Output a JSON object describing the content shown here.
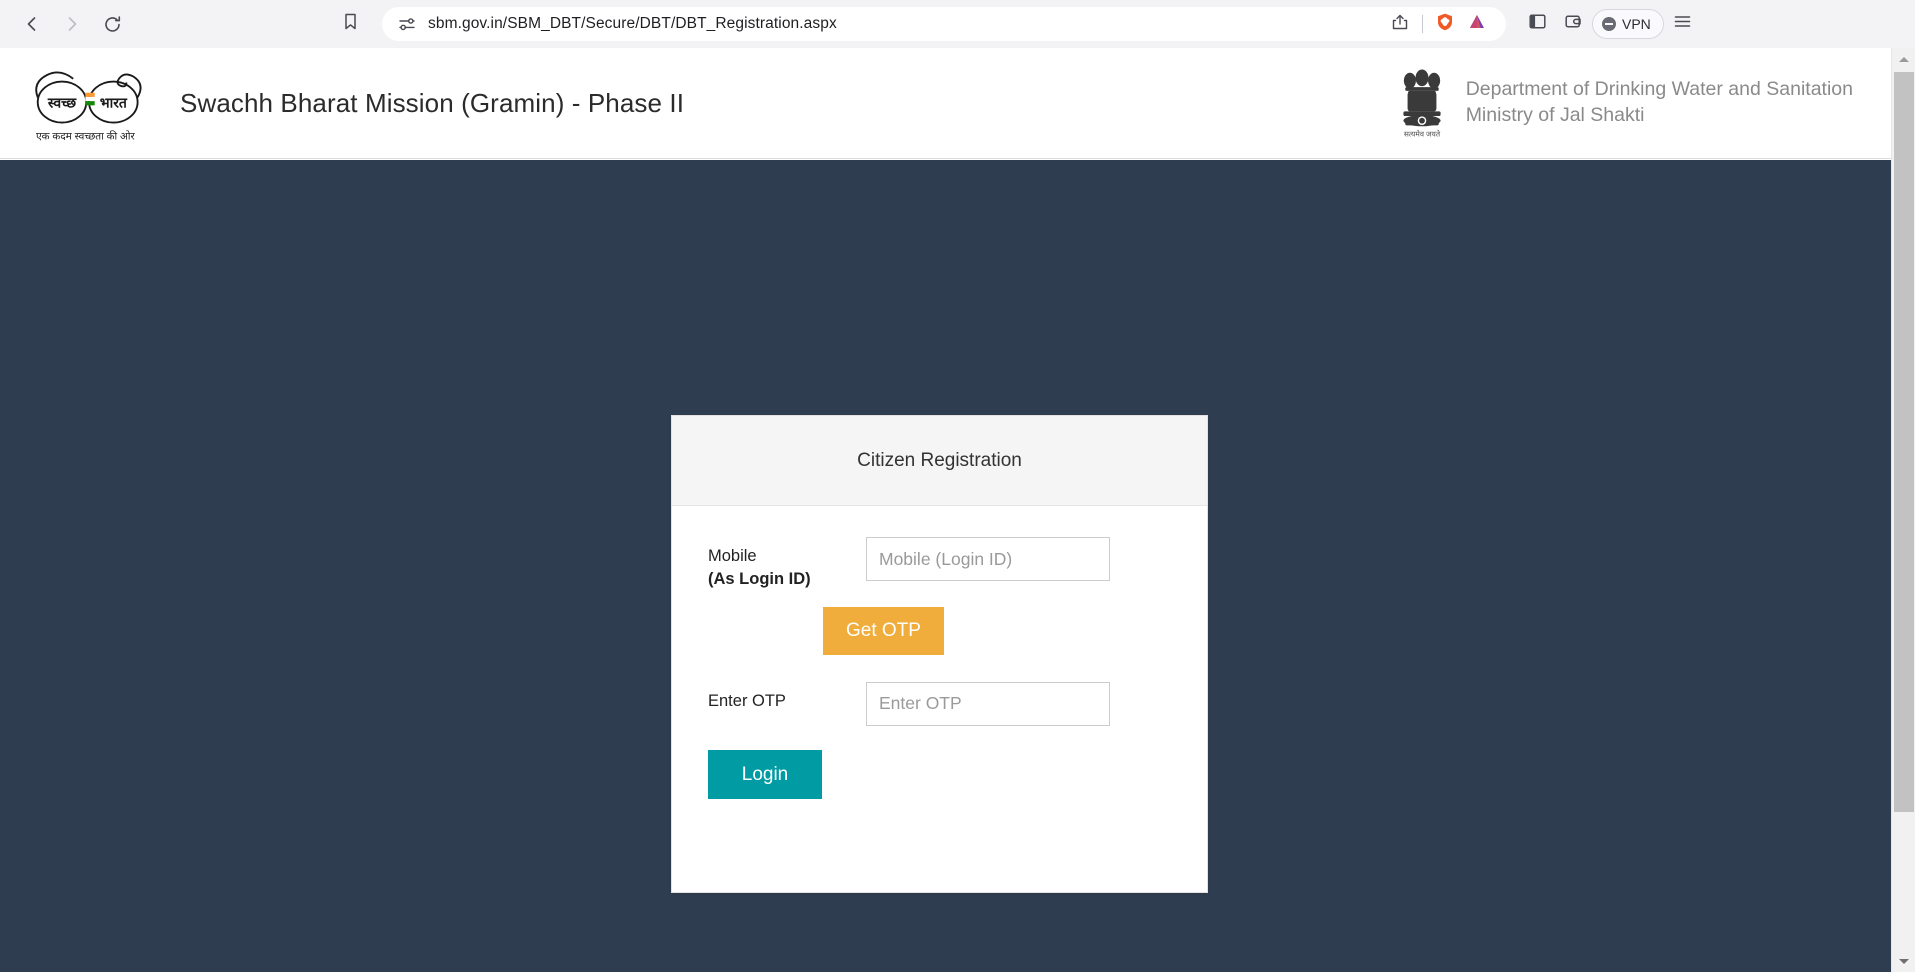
{
  "browser": {
    "back_icon": "back-arrow-icon",
    "forward_icon": "forward-arrow-icon",
    "reload_icon": "reload-icon",
    "bookmark_icon": "bookmark-icon",
    "site_settings_icon": "site-settings-sliders-icon",
    "url": "sbm.gov.in/SBM_DBT/Secure/DBT/DBT_Registration.aspx",
    "share_icon": "share-icon",
    "shields_icon": "brave-shields-lion-icon",
    "rewards_icon": "brave-rewards-triangle-icon",
    "sidebar_icon": "sidebar-toggle-icon",
    "wallet_icon": "wallet-icon",
    "vpn_label": "VPN",
    "menu_icon": "hamburger-menu-icon",
    "colors": {
      "toolbar_bg": "#f3f3f5",
      "omnibox_bg": "#ffffff",
      "brave_orange": "#f05a28",
      "brave_purple": "#7b3fb5"
    }
  },
  "site_header": {
    "logo_name": "swachh-bharat-glasses-logo",
    "logo_text_left": "स्वच्छ",
    "logo_text_right": "भारत",
    "logo_tagline": "एक कदम स्वच्छता की ओर",
    "title": "Swachh Bharat Mission (Gramin) - Phase II",
    "emblem_name": "india-national-emblem-ashoka-lion-capital",
    "emblem_motto": "सत्यमेव जयते",
    "department_line1": "Department of Drinking Water and Sanitation",
    "department_line2": "Ministry of Jal Shakti"
  },
  "page": {
    "background_color": "#2e3d4f"
  },
  "card": {
    "title": "Citizen Registration",
    "header_bg": "#f5f5f5",
    "mobile": {
      "label_line1": "Mobile",
      "label_line2": "(As Login ID)",
      "placeholder": "Mobile (Login ID)",
      "value": ""
    },
    "get_otp_button": {
      "label": "Get OTP",
      "color": "#f0ad3c"
    },
    "otp": {
      "label": "Enter OTP",
      "placeholder": "Enter OTP",
      "value": ""
    },
    "login_button": {
      "label": "Login",
      "color": "#009ba3"
    }
  },
  "scrollbar": {
    "up_arrow_icon": "scroll-up-arrow-icon",
    "down_arrow_icon": "scroll-down-arrow-icon"
  }
}
